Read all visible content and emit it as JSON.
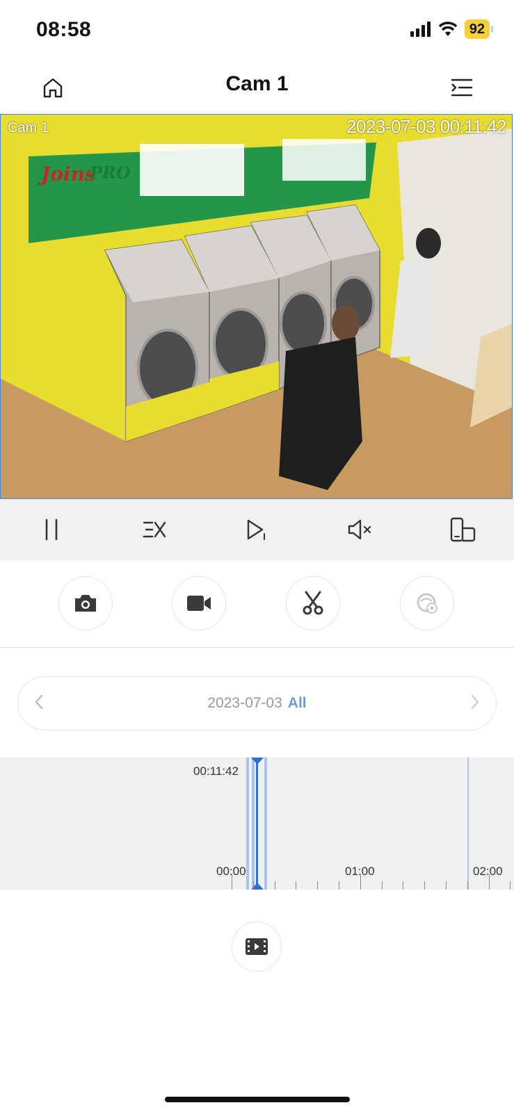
{
  "status_bar": {
    "time": "08:58",
    "battery": "92"
  },
  "nav": {
    "title": "Cam 1"
  },
  "video": {
    "camera_label": "Cam 1",
    "timestamp": "2023-07-03 00:11:42"
  },
  "date_selector": {
    "date": "2023-07-03",
    "filter": "All"
  },
  "timeline": {
    "current_time": "00:11:42",
    "tick_labels": [
      "00:00",
      "01:00",
      "02:00"
    ]
  },
  "colors": {
    "accent": "#2f6fd6",
    "filter_text": "#6a9be0",
    "battery": "#f4cf38",
    "controls_bg": "#f1f1f1"
  }
}
